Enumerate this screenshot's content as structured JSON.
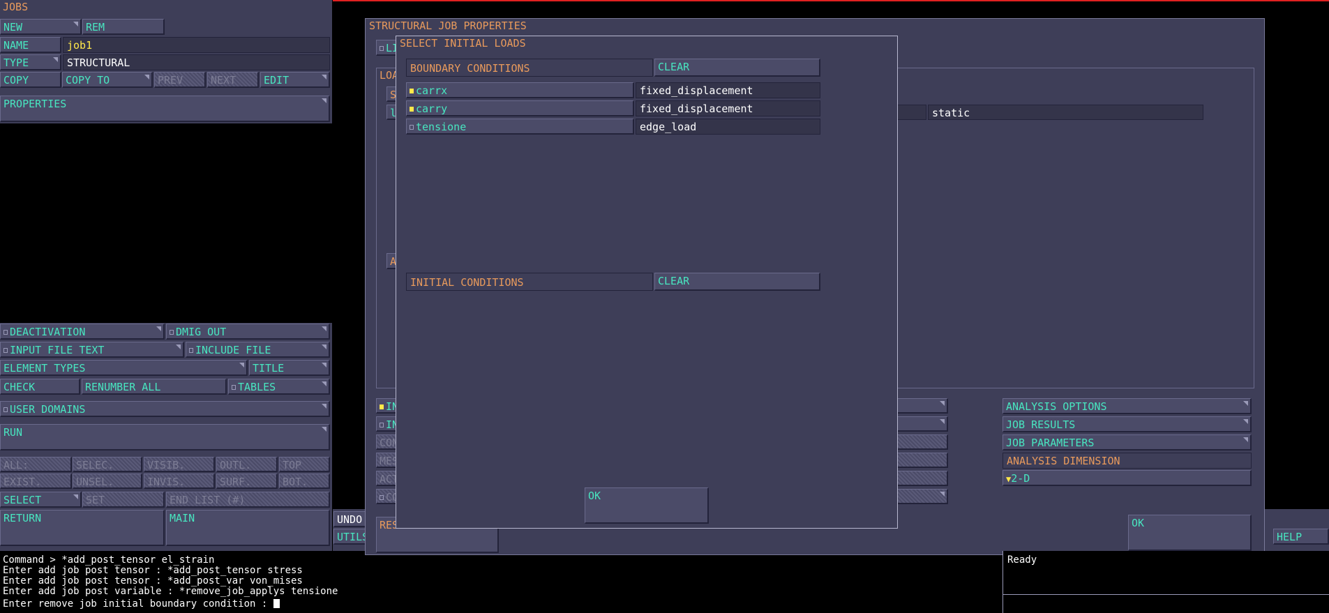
{
  "jobs_panel": {
    "title": "JOBS",
    "new": "NEW",
    "rem": "REM",
    "name_label": "NAME",
    "name_value": "job1",
    "type_label": "TYPE",
    "type_value": "STRUCTURAL",
    "copy": "COPY",
    "copy_to": "COPY TO",
    "prev": "PREV",
    "next": "NEXT",
    "edit": "EDIT",
    "properties": "PROPERTIES",
    "deactivation": "DEACTIVATION",
    "dmig_out": "DMIG OUT",
    "input_file_text": "INPUT FILE TEXT",
    "include_file": "INCLUDE FILE",
    "element_types": "ELEMENT TYPES",
    "title_btn": "TITLE",
    "check": "CHECK",
    "renumber_all": "RENUMBER ALL",
    "tables": "TABLES",
    "user_domains": "USER DOMAINS",
    "run": "RUN",
    "all": "ALL:",
    "selec": "SELEC.",
    "visib": "VISIB.",
    "outl": "OUTL.",
    "top": "TOP",
    "exist": "EXIST.",
    "unsel": "UNSEL.",
    "invis": "INVIS.",
    "surf": "SURF.",
    "bot": "BOT.",
    "select": "SELECT",
    "set": "SET",
    "end_list": "END LIST (#)",
    "return": "RETURN",
    "main": "MAIN"
  },
  "structural_dialog": {
    "title": "STRUCTURAL JOB PROPERTIES",
    "li_stub": "LI",
    "loa_stub": "LOA",
    "s_stub": "S",
    "l_stub": "l",
    "a_stub": "A",
    "static_value": "static",
    "in1_stub": "IN",
    "in2_stub": "IN",
    "con_stub": "CON",
    "mes_stub": "MES",
    "act_stub": "ACT",
    "co_stub": "CO",
    "analysis_options": "ANALYSIS OPTIONS",
    "job_results": "JOB RESULTS",
    "job_parameters": "JOB PARAMETERS",
    "analysis_dimension": "ANALYSIS DIMENSION",
    "dimension_value": "2-D",
    "res_stub": "RES",
    "ok": "OK"
  },
  "initial_loads_dialog": {
    "title": "SELECT INITIAL LOADS",
    "boundary_conditions": "BOUNDARY CONDITIONS",
    "clear_bc": "CLEAR",
    "loads": [
      {
        "name": "carrx",
        "type": "fixed_displacement",
        "checked": true
      },
      {
        "name": "carry",
        "type": "fixed_displacement",
        "checked": true
      },
      {
        "name": "tensione",
        "type": "edge_load",
        "checked": false
      }
    ],
    "initial_conditions": "INITIAL CONDITIONS",
    "clear_ic": "CLEAR",
    "ok": "OK"
  },
  "bottom_right": {
    "undo_stub": "UNDO",
    "utils_stub": "UTILS",
    "help": "HELP",
    "status": "Ready"
  },
  "console": {
    "lines": [
      "Command > *add_post_tensor el_strain",
      "Enter add job post tensor : *add_post_tensor stress",
      "Enter add job post tensor : *add_post_var von_mises",
      "Enter add job post variable : *remove_job_applys tensione",
      "Enter remove job initial boundary condition : "
    ]
  }
}
